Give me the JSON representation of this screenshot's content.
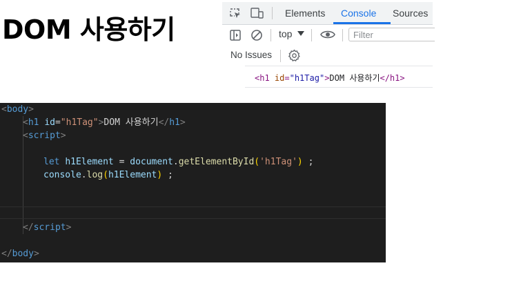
{
  "page": {
    "title": "DOM 사용하기"
  },
  "devtools": {
    "tabs": [
      {
        "label": "Elements",
        "active": false
      },
      {
        "label": "Console",
        "active": true
      },
      {
        "label": "Sources",
        "active": false
      }
    ],
    "toolbar": {
      "context": "top",
      "filter_placeholder": "Filter",
      "icons": [
        "sidebar-toggle-icon",
        "clear-console-icon",
        "dropdown-caret-icon",
        "eye-icon"
      ]
    },
    "issues": {
      "label": "No Issues"
    },
    "console_output": {
      "open_tag": "<h1",
      "attr_name": "id",
      "attr_eq": "=",
      "attr_value": "\"h1Tag\"",
      "tag_close": ">",
      "text": "DOM 사용하기",
      "end_tag": "</h1>"
    },
    "accent_color": "#1a73e8"
  },
  "editor": {
    "body_open": {
      "lt": "<",
      "name": "body",
      "gt": ">"
    },
    "h1_line": {
      "lt": "<",
      "name": "h1",
      "attr": "id",
      "eq": "=",
      "value": "\"h1Tag\"",
      "gt": ">",
      "text": "DOM 사용하기",
      "close_lt": "</",
      "close_name": "h1",
      "close_gt": ">"
    },
    "script_open": {
      "lt": "<",
      "name": "script",
      "gt": ">"
    },
    "let_line": {
      "keyword": "let",
      "var": "h1Element",
      "op": "=",
      "obj": "document",
      "dot": ".",
      "fn": "getElementById",
      "lparen": "(",
      "arg": "'h1Tag'",
      "rparen": ")",
      "semi": ";"
    },
    "log_line": {
      "obj": "console",
      "dot": ".",
      "fn": "log",
      "lparen": "(",
      "arg": "h1Element",
      "rparen": ")",
      "semi": ";"
    },
    "script_close": {
      "lt": "</",
      "name": "script",
      "gt": ">"
    },
    "body_close": {
      "lt": "</",
      "name": "body",
      "gt": ">"
    }
  }
}
